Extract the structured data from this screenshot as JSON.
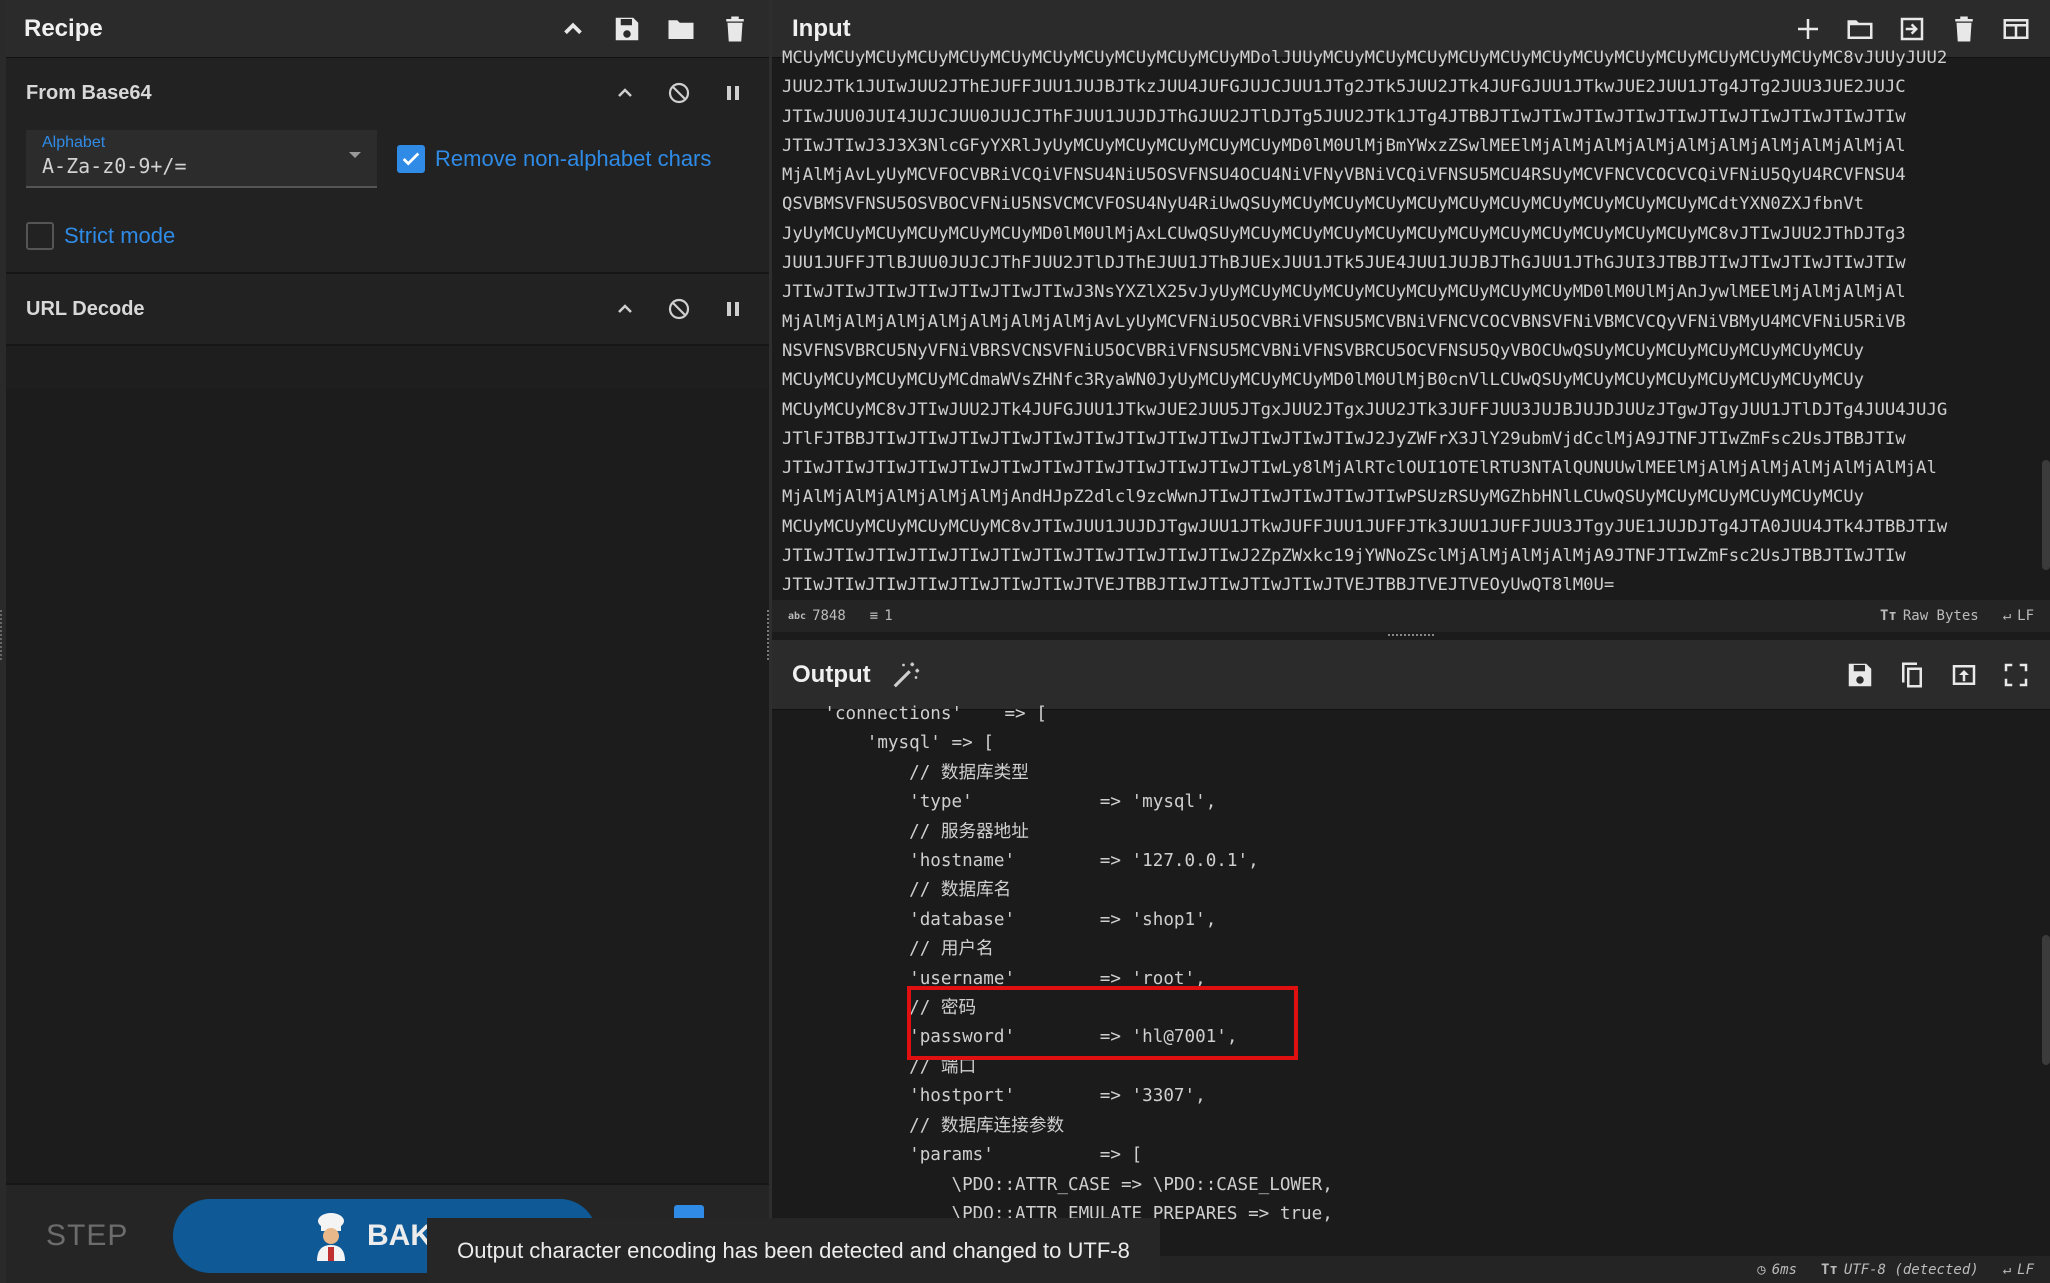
{
  "recipe": {
    "title": "Recipe",
    "operations": [
      {
        "title": "From Base64",
        "alphabet_label": "Alphabet",
        "alphabet_value": "A-Za-z0-9+/=",
        "remove_nonalpha_label": "Remove non-alphabet chars",
        "remove_nonalpha_checked": true,
        "strict_label": "Strict mode",
        "strict_checked": false
      },
      {
        "title": "URL Decode"
      }
    ],
    "step_label": "STEP",
    "bake_label": "BAKE!"
  },
  "input": {
    "title": "Input",
    "lines": [
      "MCUyMCUyMCUyMCUyMCUyMCUyMCUyMCUyMCUyMCUyMCUyMDolJUUyMCUyMCUyMCUyMCUyMCUyMCUyMCUyMCUyMCUyMCUyMCUyMCUyMC8vJUUyJUU2",
      "JUU2JTk1JUIwJUU2JThEJUFFJUU1JUJBJTkzJUU4JUFGJUJCJUU1JTg2JTk5JUU2JTk4JUFGJUU1JTkwJUE2JUU1JTg4JTg2JUU3JUE2JUJC",
      "JTIwJUU0JUI4JUJCJUU0JUJCJThFJUU1JUJDJThGJUU2JTlDJTg5JUU2JTk1JTg4JTBBJTIwJTIwJTIwJTIwJTIwJTIwJTIwJTIwJTIwJTIw",
      "JTIwJTIwJ3J3X3NlcGFyYXRlJyUyMCUyMCUyMCUyMCUyMCUyMD0lM0UlMjBmYWxzZSwlMEElMjAlMjAlMjAlMjAlMjAlMjAlMjAlMjAlMjAl",
      "MjAlMjAvLyUyMCVFOCVBRiVCQiVFNSU4NiU5OSVFNSU4OCU4NiVFNyVBNiVCQiVFNSU5MCU4RSUyMCVFNCVCOCVCQiVFNiU5QyU4RCVFNSU4",
      "QSVBMSVFNSU5OSVBOCVFNiU5NSVCMCVFOSU4NyU4RiUwQSUyMCUyMCUyMCUyMCUyMCUyMCUyMCUyMCUyMCUyMCUyMCdtYXN0ZXJfbnVt",
      "JyUyMCUyMCUyMCUyMCUyMCUyMD0lM0UlMjAxLCUwQSUyMCUyMCUyMCUyMCUyMCUyMCUyMCUyMCUyMCUyMCUyMCUyMC8vJTIwJUU2JThDJTg3",
      "JUU1JUFFJTlBJUU0JUJCJThFJUU2JTlDJThEJUU1JThBJUExJUU1JTk5JUE4JUU1JUJBJThGJUU1JThGJUI3JTBBJTIwJTIwJTIwJTIwJTIw",
      "JTIwJTIwJTIwJTIwJTIwJTIwJTIwJ3NsYXZlX25vJyUyMCUyMCUyMCUyMCUyMCUyMCUyMCUyMCUyMD0lM0UlMjAnJywlMEElMjAlMjAlMjAl",
      "MjAlMjAlMjAlMjAlMjAlMjAlMjAlMjAvLyUyMCVFNiU5OCVBRiVFNSU5MCVBNiVFNCVCOCVBNSVFNiVBMCVCQyVFNiVBMyU4MCVFNiU5RiVB",
      "NSVFNSVBRCU5NyVFNiVBRSVCNSVFNiU5OCVBRiVFNSU5MCVBNiVFNSVBRCU5OCVFNSU5QyVBOCUwQSUyMCUyMCUyMCUyMCUyMCUyMCUy",
      "MCUyMCUyMCUyMCUyMCdmaWVsZHNfc3RyaWN0JyUyMCUyMCUyMCUyMD0lM0UlMjB0cnVlLCUwQSUyMCUyMCUyMCUyMCUyMCUyMCUyMCUy",
      "MCUyMCUyMC8vJTIwJUU2JTk4JUFGJUU1JTkwJUE2JUU5JTgxJUU2JTgxJUU2JTk3JUFFJUU3JUJBJUJDJUUzJTgwJTgyJUU1JTlDJTg4JUU4JUJG",
      "JTlFJTBBJTIwJTIwJTIwJTIwJTIwJTIwJTIwJTIwJTIwJTIwJTIwJTIwJ2JyZWFrX3JlY29ubmVjdCclMjA9JTNFJTIwZmFsc2UsJTBBJTIw",
      "JTIwJTIwJTIwJTIwJTIwJTIwJTIwJTIwJTIwJTIwJTIwJTIwLy8lMjAlRTclOUI1OTElRTU3NTAlQUNUUwlMEElMjAlMjAlMjAlMjAlMjAlMjAl",
      "MjAlMjAlMjAlMjAlMjAlMjAndHJpZ2dlcl9zcWwnJTIwJTIwJTIwJTIwJTIwPSUzRSUyMGZhbHNlLCUwQSUyMCUyMCUyMCUyMCUyMCUy",
      "MCUyMCUyMCUyMCUyMCUyMC8vJTIwJUU1JUJDJTgwJUU1JTkwJUFFJUU1JUFFJTk3JUU1JUFFJUU3JTgyJUE1JUJDJTg4JTA0JUU4JTk4JTBBJTIw",
      "JTIwJTIwJTIwJTIwJTIwJTIwJTIwJTIwJTIwJTIwJTIwJ2ZpZWxkc19jYWNoZSclMjAlMjAlMjAlMjA9JTNFJTIwZmFsc2UsJTBBJTIwJTIw",
      "JTIwJTIwJTIwJTIwJTIwJTIwJTIwJTVEJTBBJTIwJTIwJTIwJTIwJTVEJTBBJTVEJTVEOyUwQT8lM0U="
    ],
    "length": "7848",
    "lines_count": "1",
    "encoding": "Raw Bytes",
    "eol": "LF"
  },
  "output": {
    "title": "Output",
    "lines": [
      "    'connections'    => [",
      "        'mysql' => [",
      "            // 数据库类型",
      "            'type'            => 'mysql',",
      "            // 服务器地址",
      "            'hostname'        => '127.0.0.1',",
      "            // 数据库名",
      "            'database'        => 'shop1',",
      "            // 用户名",
      "            'username'        => 'root',",
      "            // 密码",
      "            'password'        => 'hl@7001',",
      "            // 端口",
      "            'hostport'        => '3307',",
      "            // 数据库连接参数",
      "            'params'          => [",
      "                \\PDO::ATTR_CASE => \\PDO::CASE_LOWER,",
      "                \\PDO::ATTR_EMULATE_PREPARES => true,"
    ],
    "time": "6ms",
    "encoding": "UTF-8 (detected)",
    "eol": "LF"
  },
  "toast": "Output character encoding has been detected and changed to UTF-8",
  "colors": {
    "accent": "#2f8be6",
    "bake_button": "#0f5a96",
    "highlight_box": "#e01010"
  },
  "icons": {
    "recipe_header": [
      "chevron-up-icon",
      "save-icon",
      "folder-icon",
      "trash-icon"
    ],
    "operation_controls": [
      "chevron-up-icon",
      "disable-icon",
      "pause-icon"
    ],
    "input_header": [
      "plus-icon",
      "folder-icon",
      "import-icon",
      "trash-icon",
      "layout-icon"
    ],
    "output_header": [
      "save-icon",
      "copy-icon",
      "replace-input-icon",
      "maximize-icon"
    ],
    "magic": "magic-wand-icon"
  }
}
